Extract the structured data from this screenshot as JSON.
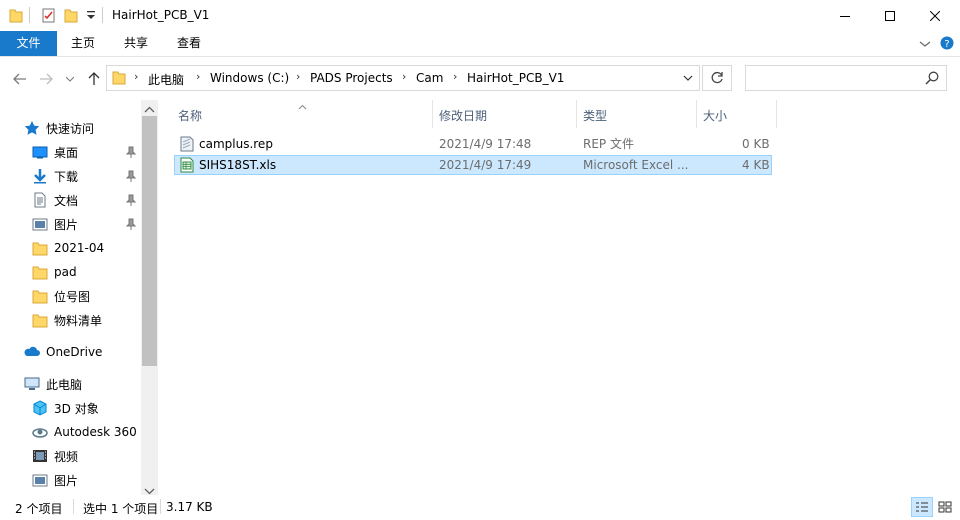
{
  "window": {
    "title": "HairHot_PCB_V1"
  },
  "ribbon": {
    "tabs": [
      "文件",
      "主页",
      "共享",
      "查看"
    ]
  },
  "address": {
    "crumbs": [
      "此电脑",
      "Windows (C:)",
      "PADS Projects",
      "Cam",
      "HairHot_PCB_V1"
    ],
    "search_placeholder": ""
  },
  "sidebar": {
    "quick_access": "快速访问",
    "items": [
      {
        "label": "桌面",
        "icon": "desktop-icon",
        "pinned": true
      },
      {
        "label": "下载",
        "icon": "download-icon",
        "pinned": true
      },
      {
        "label": "文档",
        "icon": "document-icon",
        "pinned": true
      },
      {
        "label": "图片",
        "icon": "pictures-icon",
        "pinned": true
      },
      {
        "label": "2021-04",
        "icon": "folder-icon",
        "pinned": false
      },
      {
        "label": "pad",
        "icon": "folder-icon",
        "pinned": false
      },
      {
        "label": "位号图",
        "icon": "folder-icon",
        "pinned": false
      },
      {
        "label": "物料清单",
        "icon": "folder-icon",
        "pinned": false
      }
    ],
    "onedrive": "OneDrive",
    "this_pc": "此电脑",
    "pc_items": [
      {
        "label": "3D 对象",
        "icon": "3d-objects-icon"
      },
      {
        "label": "Autodesk 360",
        "icon": "autodesk-icon"
      },
      {
        "label": "视频",
        "icon": "video-icon"
      },
      {
        "label": "图片",
        "icon": "pictures-icon"
      }
    ]
  },
  "columns": {
    "name": "名称",
    "date": "修改日期",
    "type": "类型",
    "size": "大小"
  },
  "files": [
    {
      "name": "camplus.rep",
      "date": "2021/4/9 17:48",
      "type": "REP 文件",
      "size": "0 KB",
      "icon": "text-file-icon",
      "selected": false
    },
    {
      "name": "SIHS18ST.xls",
      "date": "2021/4/9 17:49",
      "type": "Microsoft Excel ...",
      "size": "4 KB",
      "icon": "excel-file-icon",
      "selected": true
    }
  ],
  "status": {
    "count": "2 个项目",
    "selected": "选中 1 个项目",
    "size": "3.17 KB"
  },
  "colors": {
    "accent": "#1979ca",
    "selection": "#cce8ff",
    "folder": "#ffd766"
  }
}
